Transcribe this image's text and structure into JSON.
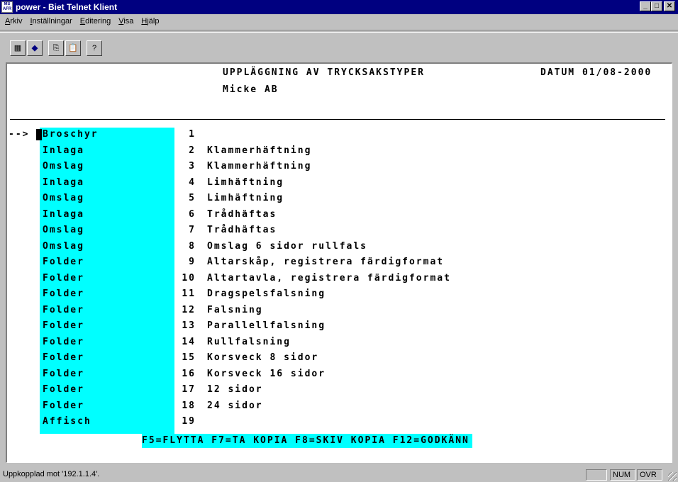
{
  "window": {
    "icon_text": "MS AFR",
    "title": "power - Biet Telnet Klient",
    "minimize": "_",
    "maximize": "□",
    "close": "✕"
  },
  "menu": [
    {
      "key": "A",
      "rest": "rkiv"
    },
    {
      "key": "I",
      "rest": "nställningar"
    },
    {
      "key": "E",
      "rest": "ditering"
    },
    {
      "key": "V",
      "rest": "isa"
    },
    {
      "key": "H",
      "rest": "jälp"
    }
  ],
  "toolbar": {
    "buttons": [
      "calculator-icon",
      "connect-icon",
      "copy-icon",
      "paste-icon",
      "help-icon"
    ],
    "glyphs": [
      "▦",
      "◆",
      "⎘",
      "📋",
      "?"
    ]
  },
  "terminal": {
    "title": "UPPLÄGGNING AV TRYCKSAKSTYPER",
    "date": "DATUM 01/08-2000",
    "company": "Micke AB",
    "arrow": "-->",
    "rows": [
      {
        "cat": "Broschyr",
        "num": "1",
        "desc": ""
      },
      {
        "cat": "Inlaga",
        "num": "2",
        "desc": "Klammerhäftning"
      },
      {
        "cat": "Omslag",
        "num": "3",
        "desc": "Klammerhäftning"
      },
      {
        "cat": "Inlaga",
        "num": "4",
        "desc": "Limhäftning"
      },
      {
        "cat": "Omslag",
        "num": "5",
        "desc": "Limhäftning"
      },
      {
        "cat": "Inlaga",
        "num": "6",
        "desc": "Trådhäftas"
      },
      {
        "cat": "Omslag",
        "num": "7",
        "desc": "Trådhäftas"
      },
      {
        "cat": "Omslag",
        "num": "8",
        "desc": "Omslag 6 sidor rullfals"
      },
      {
        "cat": "Folder",
        "num": "9",
        "desc": "Altarskåp, registrera färdigformat"
      },
      {
        "cat": "Folder",
        "num": "10",
        "desc": "Altartavla, registrera färdigformat"
      },
      {
        "cat": "Folder",
        "num": "11",
        "desc": "Dragspelsfalsning"
      },
      {
        "cat": "Folder",
        "num": "12",
        "desc": "Falsning"
      },
      {
        "cat": "Folder",
        "num": "13",
        "desc": "Parallellfalsning"
      },
      {
        "cat": "Folder",
        "num": "14",
        "desc": "Rullfalsning"
      },
      {
        "cat": "Folder",
        "num": "15",
        "desc": "Korsveck 8 sidor"
      },
      {
        "cat": "Folder",
        "num": "16",
        "desc": "Korsveck 16 sidor"
      },
      {
        "cat": "Folder",
        "num": "17",
        "desc": "12 sidor"
      },
      {
        "cat": "Folder",
        "num": "18",
        "desc": "24 sidor"
      },
      {
        "cat": "Affisch",
        "num": "19",
        "desc": ""
      }
    ],
    "function_keys": "F5=FLYTTA F7=TA KOPIA F8=SKIV KOPIA F12=GODKÄNN"
  },
  "status": {
    "connection": "Uppkopplad mot '192.1.1.4'.",
    "num": "NUM",
    "ovr": "OVR"
  },
  "colors": {
    "highlight": "#00ffff",
    "titlebar": "#000080",
    "chrome": "#c0c0c0"
  }
}
